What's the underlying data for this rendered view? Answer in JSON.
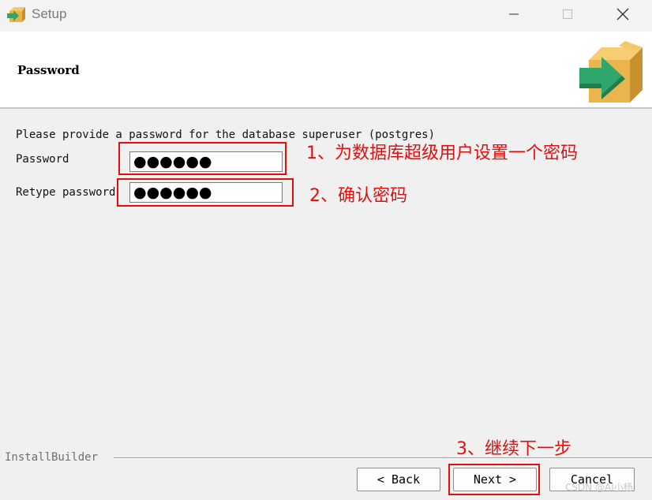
{
  "window": {
    "title": "Setup",
    "icons": {
      "app": "box-arrow-icon",
      "minimize": "minimize-icon",
      "maximize": "maximize-icon",
      "close": "close-icon"
    }
  },
  "header": {
    "title": "Password",
    "logo": "box-arrow-logo"
  },
  "form": {
    "instruction": "Please provide a password for the database superuser (postgres)",
    "password_label": "Password",
    "password_value": "●●●●●●",
    "retype_label": "Retype password",
    "retype_value": "●●●●●●"
  },
  "annotations": {
    "step1": "1、为数据库超级用户设置一个密码",
    "step2": "2、确认密码",
    "step3": "3、继续下一步",
    "color": "#e01010"
  },
  "footer": {
    "brand": "InstallBuilder",
    "back_label": "< Back",
    "next_label": "Next >",
    "cancel_label": "Cancel"
  },
  "watermark": "CSDN @AI小杨"
}
